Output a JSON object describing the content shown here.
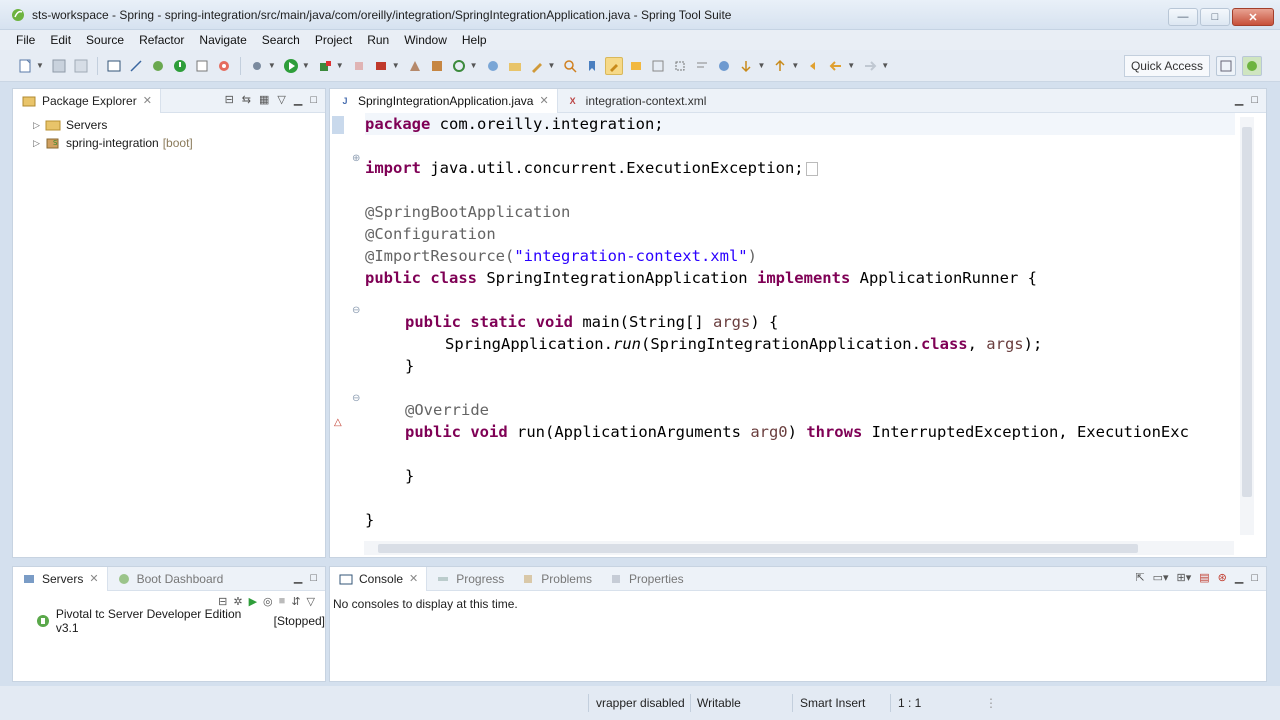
{
  "window": {
    "title": "sts-workspace - Spring - spring-integration/src/main/java/com/oreilly/integration/SpringIntegrationApplication.java - Spring Tool Suite",
    "minimize": "—",
    "maximize": "□",
    "close": "✕"
  },
  "menu": [
    "File",
    "Edit",
    "Source",
    "Refactor",
    "Navigate",
    "Search",
    "Project",
    "Run",
    "Window",
    "Help"
  ],
  "toolbar": {
    "quick_access": "Quick Access"
  },
  "package_explorer": {
    "tab": "Package Explorer",
    "items": [
      {
        "label": "Servers",
        "tag": ""
      },
      {
        "label": "spring-integration",
        "tag": "[boot]"
      }
    ]
  },
  "editor": {
    "tabs": [
      {
        "label": "SpringIntegrationApplication.java",
        "active": true
      },
      {
        "label": "integration-context.xml",
        "active": false
      }
    ],
    "code": {
      "l1_kw": "package",
      "l1_rest": " com.oreilly.integration;",
      "l2_kw": "import",
      "l2_rest": " java.util.concurrent.ExecutionException;",
      "l3": "@SpringBootApplication",
      "l4": "@Configuration",
      "l5_ann": "@ImportResource(",
      "l5_str": "\"integration-context.xml\"",
      "l5_end": ")",
      "l6_kw1": "public",
      "l6_kw2": "class",
      "l6_name": " SpringIntegrationApplication ",
      "l6_kw3": "implements",
      "l6_rest": " ApplicationRunner {",
      "l7_kw1": "public",
      "l7_kw2": "static",
      "l7_kw3": "void",
      "l7_a": " main(String[] ",
      "l7_param": "args",
      "l7_b": ") {",
      "l8_a": "SpringApplication.",
      "l8_run": "run",
      "l8_b": "(SpringIntegrationApplication.",
      "l8_kw": "class",
      "l8_c": ", ",
      "l8_param": "args",
      "l8_d": ");",
      "l9": "}",
      "l10": "@Override",
      "l11_kw1": "public",
      "l11_kw2": "void",
      "l11_a": " run(ApplicationArguments ",
      "l11_param": "arg0",
      "l11_b": ") ",
      "l11_kw3": "throws",
      "l11_c": " InterruptedException, ExecutionExc",
      "l12": "}",
      "l13": "}"
    }
  },
  "servers_view": {
    "tabs": [
      "Servers",
      "Boot Dashboard"
    ],
    "server_name": "Pivotal tc Server Developer Edition v3.1",
    "server_state": "[Stopped]"
  },
  "console_view": {
    "tabs": [
      "Console",
      "Progress",
      "Problems",
      "Properties"
    ],
    "message": "No consoles to display at this time."
  },
  "status": {
    "vrapper": "vrapper disabled",
    "writable": "Writable",
    "insert_mode": "Smart Insert",
    "position": "1 : 1"
  },
  "colors": {
    "keyword": "#7f0055",
    "string": "#2a00ff",
    "annotation": "#646464",
    "param": "#6a3e3e"
  }
}
